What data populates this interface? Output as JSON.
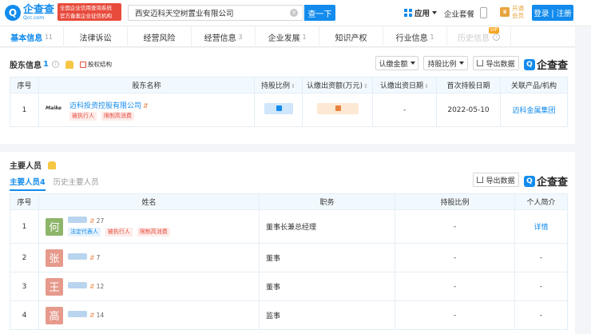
{
  "topbar": {
    "logo_mark": "Q",
    "logo_name": "企查查",
    "logo_domain": "Qcc.com",
    "gov_badge_line1": "全国企业信用查询系统",
    "gov_badge_line2": "官方备案企业征信机构",
    "search_value": "西安迈科天空树置业有限公司",
    "search_button": "查一下",
    "app_label": "应用",
    "package_label": "企业套餐",
    "vip_line1": "开通",
    "vip_line2": "会员",
    "login_label": "登录 | 注册"
  },
  "tabs": [
    {
      "label": "基本信息",
      "count": "11"
    },
    {
      "label": "法律诉讼",
      "count": ""
    },
    {
      "label": "经营风险",
      "count": ""
    },
    {
      "label": "经营信息",
      "count": "3"
    },
    {
      "label": "企业发展",
      "count": "1"
    },
    {
      "label": "知识产权",
      "count": ""
    },
    {
      "label": "行业信息",
      "count": "1"
    },
    {
      "label": "历史信息",
      "count": "",
      "badge": "VIP"
    }
  ],
  "shareholders": {
    "title": "股东信息",
    "count": "1",
    "struct_link": "股权结构",
    "filter_amount": "认缴金额",
    "filter_ratio": "持股比例",
    "export": "导出数据",
    "brand": "企查查",
    "headers": [
      "序号",
      "股东名称",
      "持股比例",
      "认缴出资额(万元)",
      "认缴出资日期",
      "首次持股日期",
      "关联产品/机构"
    ],
    "rows": [
      {
        "index": "1",
        "logo_text": "Maike",
        "name": "迈科投资控股有限公司",
        "tags": [
          "被执行人",
          "限制高消费"
        ],
        "sub_date": "-",
        "first_date": "2022-05-10",
        "product": "迈科金属集团"
      }
    ]
  },
  "personnel": {
    "title": "主要人员",
    "tab_current": "主要人员",
    "tab_current_count": "4",
    "tab_history": "历史主要人员",
    "export": "导出数据",
    "brand": "企查查",
    "headers": [
      "序号",
      "姓名",
      "职务",
      "持股比例",
      "个人简介"
    ],
    "rows": [
      {
        "index": "1",
        "avatar": "何",
        "avatar_color": "#8fb56a",
        "rel_count": "27",
        "tags": [
          "法定代表人",
          "被执行人",
          "限制高消费"
        ],
        "position": "董事长兼总经理",
        "ratio": "-",
        "bio": "详情"
      },
      {
        "index": "2",
        "avatar": "张",
        "avatar_color": "#e69a8c",
        "rel_count": "7",
        "tags": [],
        "position": "董事",
        "ratio": "-",
        "bio": "-"
      },
      {
        "index": "3",
        "avatar": "王",
        "avatar_color": "#e69a8c",
        "rel_count": "12",
        "tags": [],
        "position": "董事",
        "ratio": "-",
        "bio": "-"
      },
      {
        "index": "4",
        "avatar": "高",
        "avatar_color": "#e69a8c",
        "rel_count": "14",
        "tags": [],
        "position": "监事",
        "ratio": "-",
        "bio": "-"
      }
    ]
  }
}
